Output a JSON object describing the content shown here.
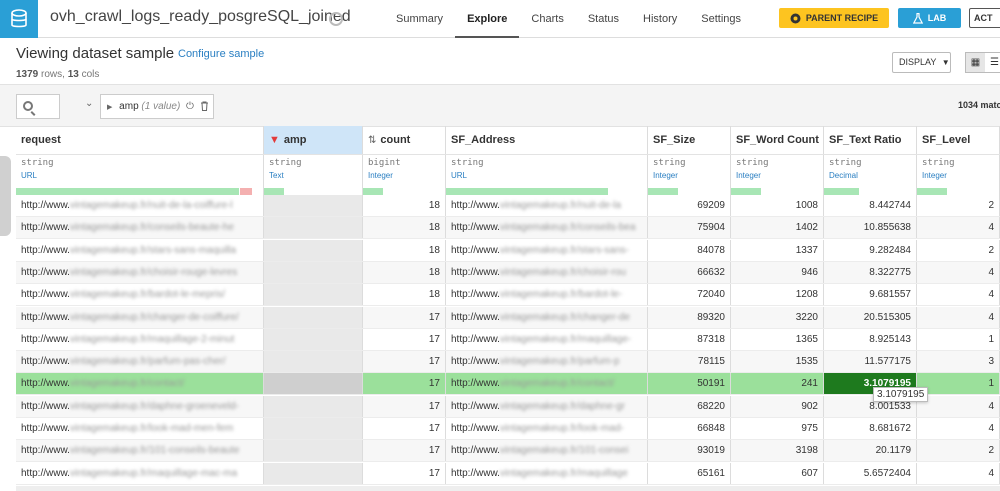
{
  "colors": {
    "brand": "#2a9fd6",
    "parent_recipe": "#fdc420",
    "highlight_row": "#9be09b",
    "focus_cell": "#1e7a1e",
    "link": "#2a7fc2"
  },
  "topbar": {
    "dataset_name": "ovh_crawl_logs_ready_posgreSQL_joined",
    "nav": [
      "Summary",
      "Explore",
      "Charts",
      "Status",
      "History",
      "Settings"
    ],
    "active_nav": "Explore",
    "parent_recipe": "PARENT RECIPE",
    "lab": "LAB",
    "actions": "ACT"
  },
  "header": {
    "title": "Viewing dataset sample",
    "configure": "Configure sample",
    "rows_count": "1379",
    "rows_label": "rows,",
    "cols_count": "13",
    "cols_label": "cols",
    "display": "DISPLAY"
  },
  "filter": {
    "column": "amp",
    "detail": "(1 value)",
    "matching": "1034 matc"
  },
  "columns": [
    {
      "name": "request",
      "storage": "string",
      "meaning": "URL"
    },
    {
      "name": "amp",
      "storage": "string",
      "meaning": "Text"
    },
    {
      "name": "count",
      "storage": "bigint",
      "meaning": "Integer"
    },
    {
      "name": "SF_Address",
      "storage": "string",
      "meaning": "URL"
    },
    {
      "name": "SF_Size",
      "storage": "string",
      "meaning": "Integer"
    },
    {
      "name": "SF_Word Count",
      "storage": "string",
      "meaning": "Integer"
    },
    {
      "name": "SF_Text Ratio",
      "storage": "string",
      "meaning": "Decimal"
    },
    {
      "name": "SF_Level",
      "storage": "string",
      "meaning": "Integer"
    }
  ],
  "rows": [
    {
      "req_prefix": "http://www.",
      "req_rest": "vintagemakeup.fr/nuit-de-la-coiffure-l",
      "count": "18",
      "addr_prefix": "http://www.",
      "addr_rest": "vintagemakeup.fr/nuit-de-la",
      "size": "69209",
      "words": "1008",
      "ratio": "8.442744",
      "level": "2"
    },
    {
      "req_prefix": "http://www.",
      "req_rest": "vintagemakeup.fr/conseils-beaute-he",
      "count": "18",
      "addr_prefix": "http://www.",
      "addr_rest": "vintagemakeup.fr/conseils-bea",
      "size": "75904",
      "words": "1402",
      "ratio": "10.855638",
      "level": "4"
    },
    {
      "req_prefix": "http://www.",
      "req_rest": "vintagemakeup.fr/stars-sans-maquilla",
      "count": "18",
      "addr_prefix": "http://www.",
      "addr_rest": "vintagemakeup.fr/stars-sans-",
      "size": "84078",
      "words": "1337",
      "ratio": "9.282484",
      "level": "2"
    },
    {
      "req_prefix": "http://www.",
      "req_rest": "vintagemakeup.fr/choisir-rouge-levres",
      "count": "18",
      "addr_prefix": "http://www.",
      "addr_rest": "vintagemakeup.fr/choisir-rou",
      "size": "66632",
      "words": "946",
      "ratio": "8.322775",
      "level": "4"
    },
    {
      "req_prefix": "http://www.",
      "req_rest": "vintagemakeup.fr/bardot-le-mepris/",
      "count": "18",
      "addr_prefix": "http://www.",
      "addr_rest": "vintagemakeup.fr/bardot-le-",
      "size": "72040",
      "words": "1208",
      "ratio": "9.681557",
      "level": "4"
    },
    {
      "req_prefix": "http://www.",
      "req_rest": "vintagemakeup.fr/changer-de-coiffure/",
      "count": "17",
      "addr_prefix": "http://www.",
      "addr_rest": "vintagemakeup.fr/changer-de",
      "size": "89320",
      "words": "3220",
      "ratio": "20.515305",
      "level": "4"
    },
    {
      "req_prefix": "http://www.",
      "req_rest": "vintagemakeup.fr/maquillage-2-minut",
      "count": "17",
      "addr_prefix": "http://www.",
      "addr_rest": "vintagemakeup.fr/maquillage-",
      "size": "87318",
      "words": "1365",
      "req": "",
      "ratio": "8.925143",
      "level": "1"
    },
    {
      "req_prefix": "http://www.",
      "req_rest": "vintagemakeup.fr/parfum-pas-cher/",
      "count": "17",
      "addr_prefix": "http://www.",
      "addr_rest": "vintagemakeup.fr/parfum-p",
      "size": "78115",
      "words": "1535",
      "ratio": "11.577175",
      "level": "3"
    },
    {
      "req_prefix": "http://www.",
      "req_rest": "vintagemakeup.fr/contact/",
      "count": "17",
      "addr_prefix": "http://www.",
      "addr_rest": "vintagemakeup.fr/contact/",
      "size": "50191",
      "words": "241",
      "ratio": "3.1079195",
      "level": "1"
    },
    {
      "req_prefix": "http://www.",
      "req_rest": "vintagemakeup.fr/daphne-groeneveld-",
      "count": "17",
      "addr_prefix": "http://www.",
      "addr_rest": "vintagemakeup.fr/daphne-gr",
      "size": "68220",
      "words": "902",
      "ratio": "8.001533",
      "level": "4"
    },
    {
      "req_prefix": "http://www.",
      "req_rest": "vintagemakeup.fr/look-mad-men-fem",
      "count": "17",
      "addr_prefix": "http://www.",
      "addr_rest": "vintagemakeup.fr/look-mad-",
      "size": "66848",
      "words": "975",
      "ratio": "8.681672",
      "level": "4"
    },
    {
      "req_prefix": "http://www.",
      "req_rest": "vintagemakeup.fr/101-conseils-beaute",
      "count": "17",
      "addr_prefix": "http://www.",
      "addr_rest": "vintagemakeup.fr/101-consei",
      "size": "93019",
      "words": "3198",
      "ratio": "20.1179",
      "level": "2"
    },
    {
      "req_prefix": "http://www.",
      "req_rest": "vintagemakeup.fr/maquillage-mac-ma",
      "count": "17",
      "addr_prefix": "http://www.",
      "addr_rest": "vintagemakeup.fr/maquillage",
      "size": "65161",
      "words": "607",
      "ratio": "5.6572404",
      "level": "4"
    }
  ],
  "selected_row": 8,
  "tooltip": "3.1079195"
}
